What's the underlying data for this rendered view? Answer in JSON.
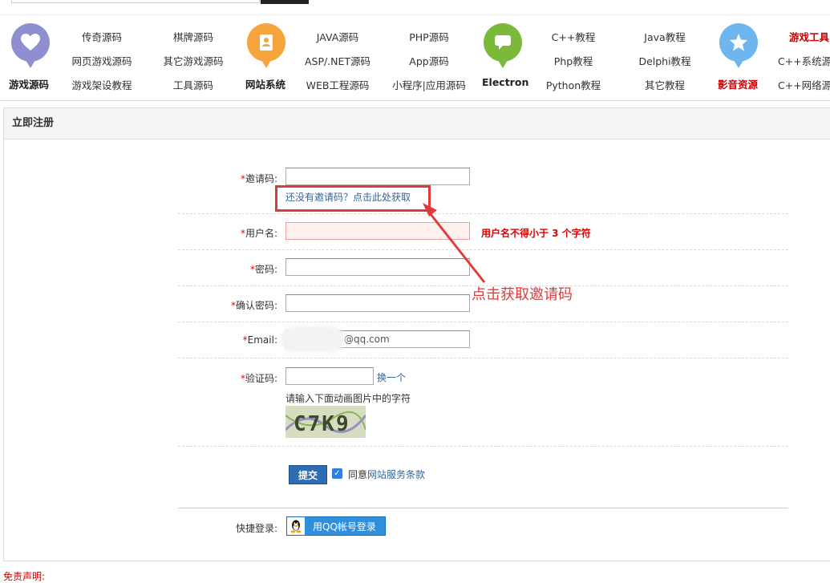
{
  "nav": {
    "groups": [
      {
        "label": "游戏源码",
        "icon": "heart-icon",
        "color": "#8e8fd1",
        "red": false
      },
      {
        "label": "网站系统",
        "icon": "contact-card-icon",
        "color": "#f6a53c",
        "red": false
      },
      {
        "label": "Electron",
        "icon": "chat-bubble-icon",
        "color": "#7bb93a",
        "red": false
      },
      {
        "label": "影音资源",
        "icon": "star-icon",
        "color": "#6fb6ee",
        "red": true
      }
    ],
    "links": [
      "传奇源码",
      "棋牌源码",
      "网页游戏源码",
      "其它游戏源码",
      "游戏架设教程",
      "工具源码",
      "JAVA源码",
      "PHP源码",
      "ASP/.NET源码",
      "App源码",
      "WEB工程源码",
      "小程序|应用源码",
      "C++教程",
      "Java教程",
      "Php教程",
      "Delphi教程",
      "Python教程",
      "其它教程",
      "游戏工具",
      "C++系统源",
      "C++网络源"
    ]
  },
  "panel": {
    "title": "立即注册"
  },
  "form": {
    "required_mark": "*",
    "invite_label": "邀请码:",
    "invite_value": "",
    "invite_hint": "还没有邀请码？点击此处获取",
    "username_label": "用户名:",
    "username_value": "",
    "username_error": "用户名不得小于 3 个字符",
    "password_label": "密码:",
    "confirm_label": "确认密码:",
    "email_label": "Email:",
    "email_value": "@qq.com",
    "captcha_label": "验证码:",
    "captcha_refresh": "换一个",
    "captcha_hint": "请输入下面动画图片中的字符",
    "captcha_text": "C7K9",
    "submit_label": "提交",
    "agree_prefix": "同意",
    "agree_link": "网站服务条款",
    "quick_login_label": "快捷登录:",
    "qq_login_label": "用QQ帐号登录"
  },
  "annotation": {
    "text": "点击获取邀请码",
    "color": "#e03b3b"
  },
  "disclaimer": "免责声明:"
}
